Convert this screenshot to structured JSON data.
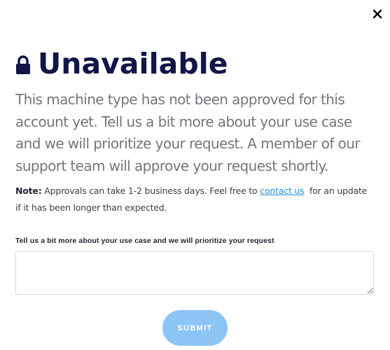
{
  "dialog": {
    "close_icon": "close-icon",
    "lock_icon": "lock-icon",
    "title": "Unavailable",
    "lead_text": "This machine type has not been approved for this account yet. Tell us a bit more about your use case and we will prioritize your request. A member of our support team will approve your request shortly.",
    "note": {
      "label": "Note:",
      "text_before_link": "Approvals can take 1-2 business days. Feel free to",
      "link_text": "contact us",
      "text_after_link": "for an update if it has been longer than expected."
    },
    "field_label": "Tell us a bit more about your use case and we will prioritize your request",
    "field_value": "",
    "field_placeholder": "",
    "submit_label": "SUBMIT",
    "colors": {
      "title": "#111547",
      "body_text": "#74767d",
      "link": "#2a8fd8",
      "submit_bg": "#8cc5f4"
    }
  }
}
